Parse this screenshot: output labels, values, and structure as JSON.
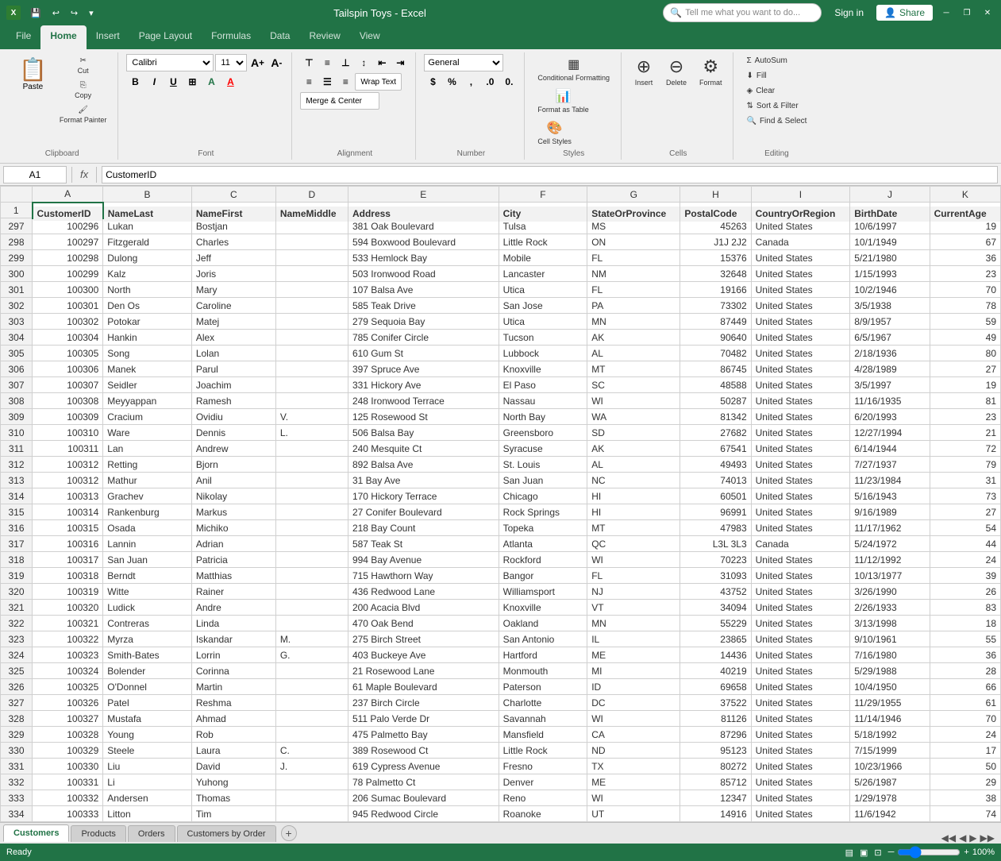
{
  "app": {
    "title": "Tailspin Toys - Excel",
    "file_icon": "X"
  },
  "titlebar": {
    "buttons": [
      "minimize",
      "restore",
      "close"
    ],
    "qat_buttons": [
      "save",
      "undo",
      "redo",
      "customize"
    ]
  },
  "ribbon": {
    "tabs": [
      "File",
      "Home",
      "Insert",
      "Page Layout",
      "Formulas",
      "Data",
      "Review",
      "View"
    ],
    "active_tab": "Home",
    "tell_me": "Tell me what you want to do...",
    "sign_in": "Sign in",
    "share": "Share",
    "groups": {
      "clipboard": "Clipboard",
      "font": "Font",
      "alignment": "Alignment",
      "number": "Number",
      "styles": "Styles",
      "cells": "Cells",
      "editing": "Editing"
    },
    "font_name": "Calibri",
    "font_size": "11",
    "number_format": "General",
    "wrap_text": "Wrap Text",
    "merge_center": "Merge & Center",
    "conditional_formatting": "Conditional Formatting",
    "format_as_table": "Format as Table",
    "cell_styles": "Cell Styles",
    "insert_label": "Insert",
    "delete_label": "Delete",
    "format_label": "Format",
    "autosum": "AutoSum",
    "fill": "Fill",
    "clear": "Clear",
    "sort_filter": "Sort & Filter",
    "find_select": "Find & Select",
    "paste_label": "Paste"
  },
  "formula_bar": {
    "name_box": "A1",
    "fx": "fx",
    "formula": "CustomerID"
  },
  "columns": {
    "row_header": "",
    "headers": [
      "A",
      "B",
      "C",
      "D",
      "E",
      "F",
      "G",
      "H",
      "I",
      "J",
      "K"
    ],
    "col_labels": [
      "CustomerID",
      "NameLast",
      "NameFirst",
      "NameMiddle",
      "Address",
      "City",
      "StateOrProvince",
      "PostalCode",
      "CountryOrRegion",
      "BirthDate",
      "CurrentAge"
    ]
  },
  "rows": [
    {
      "row": 1,
      "cells": [
        "CustomerID",
        "NameLast",
        "NameFirst",
        "NameMiddle",
        "Address",
        "City",
        "StateOrProvince",
        "PostalCode",
        "CountryOrRegion",
        "BirthDate",
        "CurrentAge"
      ],
      "is_header": true
    },
    {
      "row": 297,
      "cells": [
        "100296",
        "Lukan",
        "Bostjan",
        "",
        "381 Oak Boulevard",
        "Tulsa",
        "MS",
        "45263",
        "United States",
        "10/6/1997",
        "19"
      ]
    },
    {
      "row": 298,
      "cells": [
        "100297",
        "Fitzgerald",
        "Charles",
        "",
        "594 Boxwood Boulevard",
        "Little Rock",
        "ON",
        "J1J 2J2",
        "Canada",
        "10/1/1949",
        "67"
      ]
    },
    {
      "row": 299,
      "cells": [
        "100298",
        "Dulong",
        "Jeff",
        "",
        "533 Hemlock Bay",
        "Mobile",
        "FL",
        "15376",
        "United States",
        "5/21/1980",
        "36"
      ]
    },
    {
      "row": 300,
      "cells": [
        "100299",
        "Kalz",
        "Joris",
        "",
        "503 Ironwood Road",
        "Lancaster",
        "NM",
        "32648",
        "United States",
        "1/15/1993",
        "23"
      ]
    },
    {
      "row": 301,
      "cells": [
        "100300",
        "North",
        "Mary",
        "",
        "107 Balsa Ave",
        "Utica",
        "FL",
        "19166",
        "United States",
        "10/2/1946",
        "70"
      ]
    },
    {
      "row": 302,
      "cells": [
        "100301",
        "Den Os",
        "Caroline",
        "",
        "585 Teak Drive",
        "San Jose",
        "PA",
        "73302",
        "United States",
        "3/5/1938",
        "78"
      ]
    },
    {
      "row": 303,
      "cells": [
        "100302",
        "Potokar",
        "Matej",
        "",
        "279 Sequoia Bay",
        "Utica",
        "MN",
        "87449",
        "United States",
        "8/9/1957",
        "59"
      ]
    },
    {
      "row": 304,
      "cells": [
        "100304",
        "Hankin",
        "Alex",
        "",
        "785 Conifer Circle",
        "Tucson",
        "AK",
        "90640",
        "United States",
        "6/5/1967",
        "49"
      ]
    },
    {
      "row": 305,
      "cells": [
        "100305",
        "Song",
        "Lolan",
        "",
        "610 Gum St",
        "Lubbock",
        "AL",
        "70482",
        "United States",
        "2/18/1936",
        "80"
      ]
    },
    {
      "row": 306,
      "cells": [
        "100306",
        "Manek",
        "Parul",
        "",
        "397 Spruce Ave",
        "Knoxville",
        "MT",
        "86745",
        "United States",
        "4/28/1989",
        "27"
      ]
    },
    {
      "row": 307,
      "cells": [
        "100307",
        "Seidler",
        "Joachim",
        "",
        "331 Hickory Ave",
        "El Paso",
        "SC",
        "48588",
        "United States",
        "3/5/1997",
        "19"
      ]
    },
    {
      "row": 308,
      "cells": [
        "100308",
        "Meyyappan",
        "Ramesh",
        "",
        "248 Ironwood Terrace",
        "Nassau",
        "WI",
        "50287",
        "United States",
        "11/16/1935",
        "81"
      ]
    },
    {
      "row": 309,
      "cells": [
        "100309",
        "Cracium",
        "Ovidiu",
        "V.",
        "125 Rosewood St",
        "North Bay",
        "WA",
        "81342",
        "United States",
        "6/20/1993",
        "23"
      ]
    },
    {
      "row": 310,
      "cells": [
        "100310",
        "Ware",
        "Dennis",
        "L.",
        "506 Balsa Bay",
        "Greensboro",
        "SD",
        "27682",
        "United States",
        "12/27/1994",
        "21"
      ]
    },
    {
      "row": 311,
      "cells": [
        "100311",
        "Lan",
        "Andrew",
        "",
        "240 Mesquite Ct",
        "Syracuse",
        "AK",
        "67541",
        "United States",
        "6/14/1944",
        "72"
      ]
    },
    {
      "row": 312,
      "cells": [
        "100312",
        "Retting",
        "Bjorn",
        "",
        "892 Balsa Ave",
        "St. Louis",
        "AL",
        "49493",
        "United States",
        "7/27/1937",
        "79"
      ]
    },
    {
      "row": 313,
      "cells": [
        "100312",
        "Mathur",
        "Anil",
        "",
        "31 Bay Ave",
        "San Juan",
        "NC",
        "74013",
        "United States",
        "11/23/1984",
        "31"
      ]
    },
    {
      "row": 314,
      "cells": [
        "100313",
        "Grachev",
        "Nikolay",
        "",
        "170 Hickory Terrace",
        "Chicago",
        "HI",
        "60501",
        "United States",
        "5/16/1943",
        "73"
      ]
    },
    {
      "row": 315,
      "cells": [
        "100314",
        "Rankenburg",
        "Markus",
        "",
        "27 Conifer Boulevard",
        "Rock Springs",
        "HI",
        "96991",
        "United States",
        "9/16/1989",
        "27"
      ]
    },
    {
      "row": 316,
      "cells": [
        "100315",
        "Osada",
        "Michiko",
        "",
        "218 Bay Count",
        "Topeka",
        "MT",
        "47983",
        "United States",
        "11/17/1962",
        "54"
      ]
    },
    {
      "row": 317,
      "cells": [
        "100316",
        "Lannin",
        "Adrian",
        "",
        "587 Teak St",
        "Atlanta",
        "QC",
        "L3L 3L3",
        "Canada",
        "5/24/1972",
        "44"
      ]
    },
    {
      "row": 318,
      "cells": [
        "100317",
        "San Juan",
        "Patricia",
        "",
        "994 Bay Avenue",
        "Rockford",
        "WI",
        "70223",
        "United States",
        "11/12/1992",
        "24"
      ]
    },
    {
      "row": 319,
      "cells": [
        "100318",
        "Berndt",
        "Matthias",
        "",
        "715 Hawthorn Way",
        "Bangor",
        "FL",
        "31093",
        "United States",
        "10/13/1977",
        "39"
      ]
    },
    {
      "row": 320,
      "cells": [
        "100319",
        "Witte",
        "Rainer",
        "",
        "436 Redwood Lane",
        "Williamsport",
        "NJ",
        "43752",
        "United States",
        "3/26/1990",
        "26"
      ]
    },
    {
      "row": 321,
      "cells": [
        "100320",
        "Ludick",
        "Andre",
        "",
        "200 Acacia Blvd",
        "Knoxville",
        "VT",
        "34094",
        "United States",
        "2/26/1933",
        "83"
      ]
    },
    {
      "row": 322,
      "cells": [
        "100321",
        "Contreras",
        "Linda",
        "",
        "470 Oak Bend",
        "Oakland",
        "MN",
        "55229",
        "United States",
        "3/13/1998",
        "18"
      ]
    },
    {
      "row": 323,
      "cells": [
        "100322",
        "Myrza",
        "Iskandar",
        "M.",
        "275 Birch Street",
        "San Antonio",
        "IL",
        "23865",
        "United States",
        "9/10/1961",
        "55"
      ]
    },
    {
      "row": 324,
      "cells": [
        "100323",
        "Smith-Bates",
        "Lorrin",
        "G.",
        "403 Buckeye Ave",
        "Hartford",
        "ME",
        "14436",
        "United States",
        "7/16/1980",
        "36"
      ]
    },
    {
      "row": 325,
      "cells": [
        "100324",
        "Bolender",
        "Corinna",
        "",
        "21 Rosewood Lane",
        "Monmouth",
        "MI",
        "40219",
        "United States",
        "5/29/1988",
        "28"
      ]
    },
    {
      "row": 326,
      "cells": [
        "100325",
        "O'Donnel",
        "Martin",
        "",
        "61 Maple Boulevard",
        "Paterson",
        "ID",
        "69658",
        "United States",
        "10/4/1950",
        "66"
      ]
    },
    {
      "row": 327,
      "cells": [
        "100326",
        "Patel",
        "Reshma",
        "",
        "237 Birch Circle",
        "Charlotte",
        "DC",
        "37522",
        "United States",
        "11/29/1955",
        "61"
      ]
    },
    {
      "row": 328,
      "cells": [
        "100327",
        "Mustafa",
        "Ahmad",
        "",
        "511 Palo Verde Dr",
        "Savannah",
        "WI",
        "81126",
        "United States",
        "11/14/1946",
        "70"
      ]
    },
    {
      "row": 329,
      "cells": [
        "100328",
        "Young",
        "Rob",
        "",
        "475 Palmetto Bay",
        "Mansfield",
        "CA",
        "87296",
        "United States",
        "5/18/1992",
        "24"
      ]
    },
    {
      "row": 330,
      "cells": [
        "100329",
        "Steele",
        "Laura",
        "C.",
        "389 Rosewood Ct",
        "Little Rock",
        "ND",
        "95123",
        "United States",
        "7/15/1999",
        "17"
      ]
    },
    {
      "row": 331,
      "cells": [
        "100330",
        "Liu",
        "David",
        "J.",
        "619 Cypress Avenue",
        "Fresno",
        "TX",
        "80272",
        "United States",
        "10/23/1966",
        "50"
      ]
    },
    {
      "row": 332,
      "cells": [
        "100331",
        "Li",
        "Yuhong",
        "",
        "78 Palmetto Ct",
        "Denver",
        "ME",
        "85712",
        "United States",
        "5/26/1987",
        "29"
      ]
    },
    {
      "row": 333,
      "cells": [
        "100332",
        "Andersen",
        "Thomas",
        "",
        "206 Sumac Boulevard",
        "Reno",
        "WI",
        "12347",
        "United States",
        "1/29/1978",
        "38"
      ]
    },
    {
      "row": 334,
      "cells": [
        "100333",
        "Litton",
        "Tim",
        "",
        "945 Redwood Circle",
        "Roanoke",
        "UT",
        "14916",
        "United States",
        "11/6/1942",
        "74"
      ]
    }
  ],
  "tabs": {
    "sheets": [
      "Customers",
      "Products",
      "Orders",
      "Customers by Order"
    ],
    "active": "Customers"
  },
  "status_bar": {
    "status": "Ready",
    "view_normal": "Normal",
    "view_page_layout": "Page Layout",
    "view_page_break": "Page Break",
    "zoom_percent": "100%"
  }
}
